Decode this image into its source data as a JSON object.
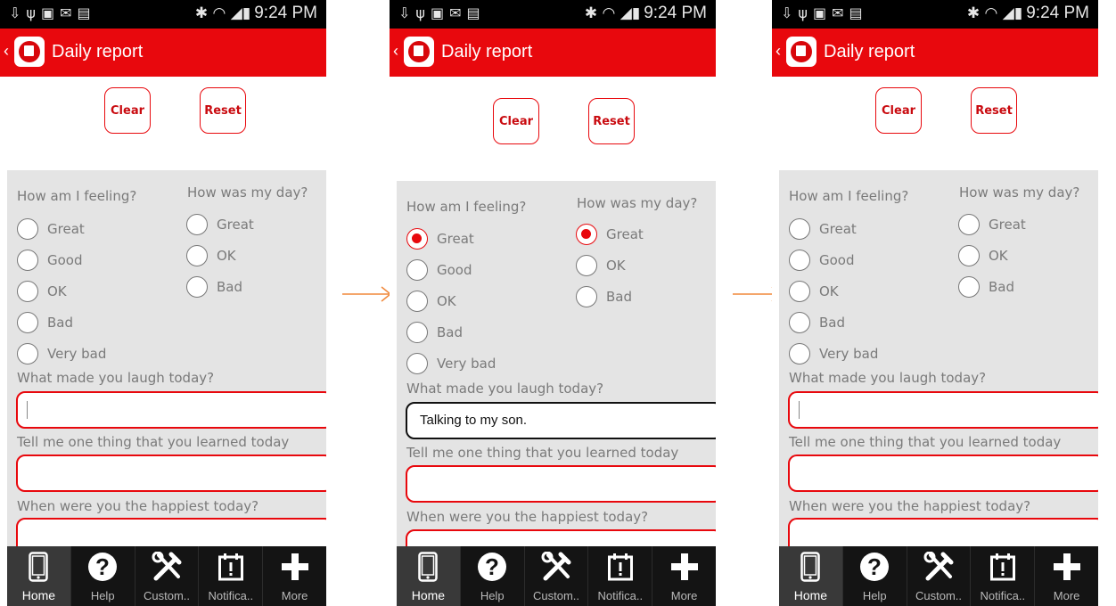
{
  "status_bar": {
    "time": "9:24 PM",
    "left_icons": [
      "download-icon",
      "usb-icon",
      "image-icon",
      "mail-icon",
      "voicemail-icon"
    ],
    "right_icons": [
      "bluetooth-icon",
      "wifi-icon",
      "signal-icon",
      "battery-icon"
    ]
  },
  "app_bar": {
    "title": "Daily report",
    "back": "‹"
  },
  "buttons": {
    "clear": "Clear",
    "reset": "Reset"
  },
  "questions": {
    "feeling": {
      "label": "How am I feeling?",
      "options": [
        "Great",
        "Good",
        "OK",
        "Bad",
        "Very bad"
      ]
    },
    "day": {
      "label": "How was my day?",
      "options": [
        "Great",
        "OK",
        "Bad"
      ]
    },
    "laugh": "What made you laugh today?",
    "learned": "Tell me one thing that you learned today",
    "happiest": "When were you the happiest today?"
  },
  "screens": [
    {
      "feeling_selected": null,
      "day_selected": null,
      "laugh_value": "",
      "laugh_focused": true
    },
    {
      "feeling_selected": "Great",
      "day_selected": "Great",
      "laugh_value": "Talking to my son.",
      "laugh_focused": false
    },
    {
      "feeling_selected": null,
      "day_selected": null,
      "laugh_value": "",
      "laugh_focused": true
    }
  ],
  "nav": [
    "Home",
    "Help",
    "Custom..",
    "Notifica..",
    "More"
  ],
  "colors": {
    "accent": "#e8080d",
    "panel": "#e4e4e4",
    "navbar": "#141414",
    "arrow": "#f0883a"
  }
}
